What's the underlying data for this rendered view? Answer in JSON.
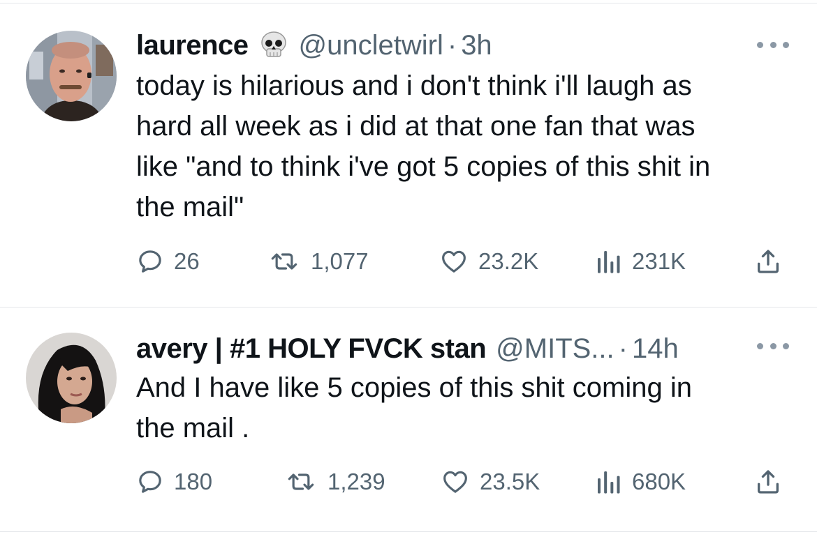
{
  "colors": {
    "text": "#0f1419",
    "secondary": "#536471",
    "divider": "#e4e7ea",
    "icon": "#536471"
  },
  "tweets": [
    {
      "display_name": "laurence",
      "badge_icon": "skull-emoji",
      "handle": "@uncletwirl",
      "separator": "·",
      "time": "3h",
      "text": "today is hilarious and i don't think i'll laugh as\nhard all week as i did at that one fan that was\nlike \"and to think i've got 5 copies of this shit in\nthe mail\"",
      "replies": "26",
      "retweets": "1,077",
      "likes": "23.2K",
      "views": "231K"
    },
    {
      "display_name": "avery | #1 HOLY FVCK stan",
      "handle": "@MITS...",
      "separator": "·",
      "time": "14h",
      "text": "And I have like 5 copies of this shit coming in\nthe mail .",
      "replies": "180",
      "retweets": "1,239",
      "likes": "23.5K",
      "views": "680K"
    }
  ]
}
